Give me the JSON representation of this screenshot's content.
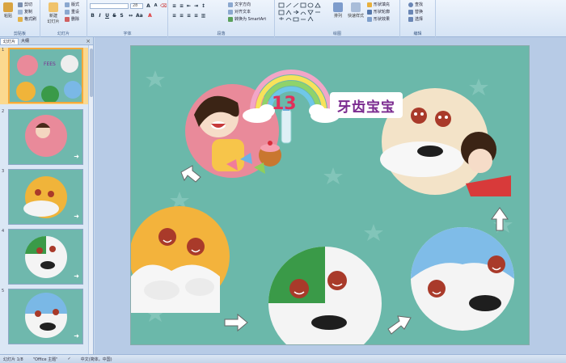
{
  "ribbon": {
    "clipboard": {
      "paste": "粘贴",
      "cut": "剪切",
      "copy": "复制",
      "format_painter": "格式刷",
      "label": "剪贴板"
    },
    "slides": {
      "new_slide": "新建\n幻灯片",
      "layout": "版式",
      "reset": "重设",
      "delete": "删除",
      "label": "幻灯片"
    },
    "font": {
      "font_name": "",
      "font_size": "28",
      "label": "字体"
    },
    "paragraph": {
      "text_direction": "文字方向",
      "align_text": "对齐文本",
      "smartart": "转换为 SmartArt",
      "label": "段落"
    },
    "drawing": {
      "arrange": "排列",
      "quick_styles": "快速样式",
      "shape_fill": "形状填充",
      "shape_outline": "形状轮廓",
      "shape_effects": "形状效果",
      "label": "绘图"
    },
    "editing": {
      "find": "查找",
      "replace": "替换",
      "select": "选择",
      "label": "编辑"
    }
  },
  "left_panel": {
    "tabs": [
      "幻灯片",
      "大纲"
    ],
    "close": "×",
    "thumbnails": [
      {
        "num": "1"
      },
      {
        "num": "2"
      },
      {
        "num": "3"
      },
      {
        "num": "4"
      },
      {
        "num": "5"
      }
    ]
  },
  "slide": {
    "title": "牙齿宝宝",
    "number": "13"
  },
  "status": {
    "slide_info": "幻灯片 1/8",
    "theme": "\"Office 主题\"",
    "language": "中文(简体，中国)"
  },
  "colors": {
    "slide_bg": "#6bb8aa",
    "ribbon_bg": "#dbe7f5",
    "accent_orange": "#f4a93b"
  }
}
